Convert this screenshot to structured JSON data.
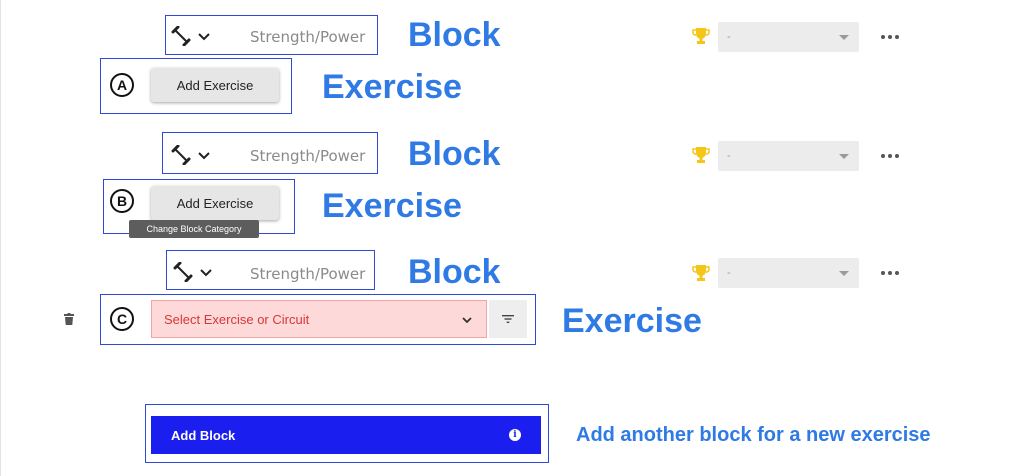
{
  "blocks": [
    {
      "category": "Strength/Power",
      "annotation": "Block",
      "dropdown_value": "-"
    },
    {
      "category": "Strength/Power",
      "annotation": "Block",
      "dropdown_value": "-"
    },
    {
      "category": "Strength/Power",
      "annotation": "Block",
      "dropdown_value": "-"
    }
  ],
  "exercises": [
    {
      "letter": "A",
      "button_label": "Add Exercise",
      "annotation": "Exercise"
    },
    {
      "letter": "B",
      "button_label": "Add Exercise",
      "annotation": "Exercise",
      "tooltip": "Change Block Category"
    },
    {
      "letter": "C",
      "select_placeholder": "Select Exercise or Circuit",
      "annotation": "Exercise"
    }
  ],
  "add_block": {
    "label": "Add Block",
    "annotation": "Add another block for a new exercise"
  },
  "colors": {
    "accent_blue": "#1a1ff0",
    "annotation_blue": "#2f7ae5",
    "trophy": "#f5c518",
    "error_red": "#d93636"
  }
}
